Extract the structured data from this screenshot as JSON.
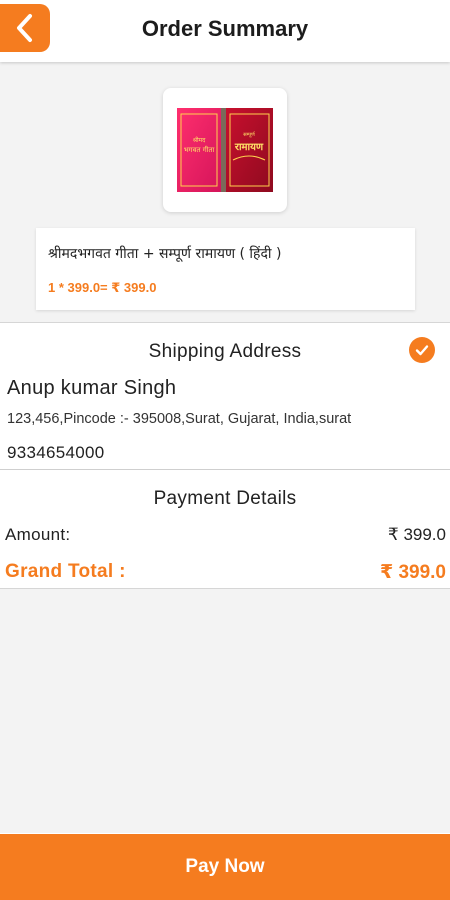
{
  "header": {
    "title": "Order Summary",
    "back_icon": "chevron-left-icon"
  },
  "colors": {
    "accent": "#f57c1f",
    "background": "#f3f3f3"
  },
  "product": {
    "name": "श्रीमदभगवत गीता + सम्पूर्ण रामायण ( हिंदी )",
    "price_line": "1 * 399.0= ₹ 399.0",
    "quantity": 1,
    "unit_price": 399.0,
    "total": 399.0
  },
  "shipping": {
    "title": "Shipping Address",
    "selected_icon": "check-circle-icon",
    "name": "Anup kumar Singh",
    "address": "123,456,Pincode :- 395008,Surat, Gujarat, India,surat",
    "phone": "9334654000"
  },
  "payment": {
    "title": "Payment Details",
    "amount_label": "Amount:",
    "amount_value": "₹ 399.0",
    "grand_total_label": "Grand Total :",
    "grand_total_value": "₹ 399.0"
  },
  "pay_button": {
    "label": "Pay Now"
  }
}
